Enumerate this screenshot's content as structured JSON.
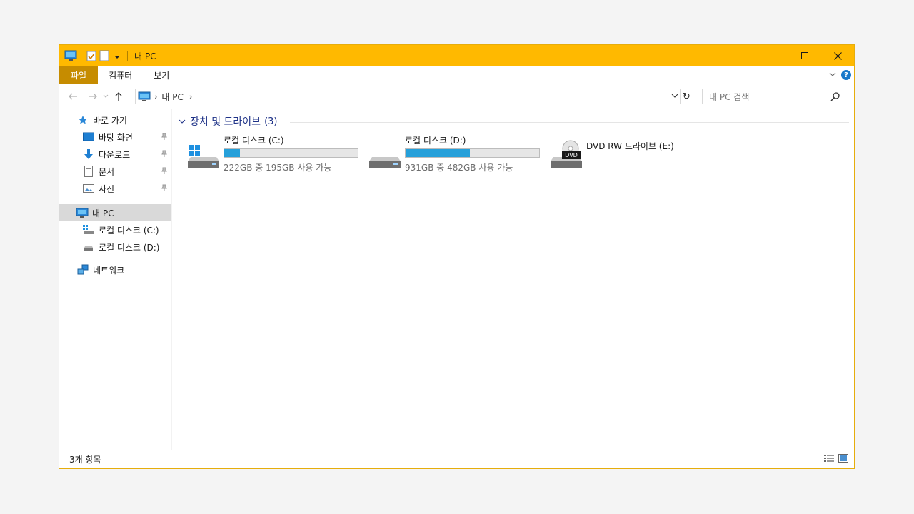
{
  "window": {
    "title": "내 PC"
  },
  "ribbon": {
    "tabs": [
      {
        "label": "파일"
      },
      {
        "label": "컴퓨터"
      },
      {
        "label": "보기"
      }
    ],
    "help_label": "?"
  },
  "navigation": {
    "address_path": [
      "내 PC"
    ],
    "search_placeholder": "내 PC 검색"
  },
  "sidebar": {
    "quick_access": {
      "label": "바로 가기",
      "items": [
        {
          "label": "바탕 화면",
          "icon": "desktop-icon",
          "pinned": true
        },
        {
          "label": "다운로드",
          "icon": "download-icon",
          "pinned": true
        },
        {
          "label": "문서",
          "icon": "document-icon",
          "pinned": true
        },
        {
          "label": "사진",
          "icon": "pictures-icon",
          "pinned": true
        }
      ]
    },
    "this_pc": {
      "label": "내 PC",
      "selected": true,
      "drives": [
        {
          "label": "로컬 디스크 (C:)",
          "icon": "windows-drive-icon"
        },
        {
          "label": "로컬 디스크 (D:)",
          "icon": "drive-icon"
        }
      ]
    },
    "network": {
      "label": "네트워크"
    }
  },
  "content": {
    "group_title": "장치 및 드라이브",
    "group_count": "(3)",
    "drives": [
      {
        "name": "로컬 디스크 (C:)",
        "size_text": "222GB 중 195GB 사용 가능",
        "used_fraction": 0.12,
        "icon": "windows-drive-icon"
      },
      {
        "name": "로컬 디스크 (D:)",
        "size_text": "931GB 중 482GB 사용 가능",
        "used_fraction": 0.48,
        "icon": "drive-icon"
      },
      {
        "name": "DVD RW 드라이브 (E:)",
        "icon": "dvd-drive-icon",
        "badge": "DVD"
      }
    ]
  },
  "status": {
    "item_count": "3개 항목"
  },
  "colors": {
    "titlebar": "#ffb900",
    "file_tab": "#c68c00",
    "accent_blue": "#26a0da",
    "group_header": "#1e3287"
  }
}
